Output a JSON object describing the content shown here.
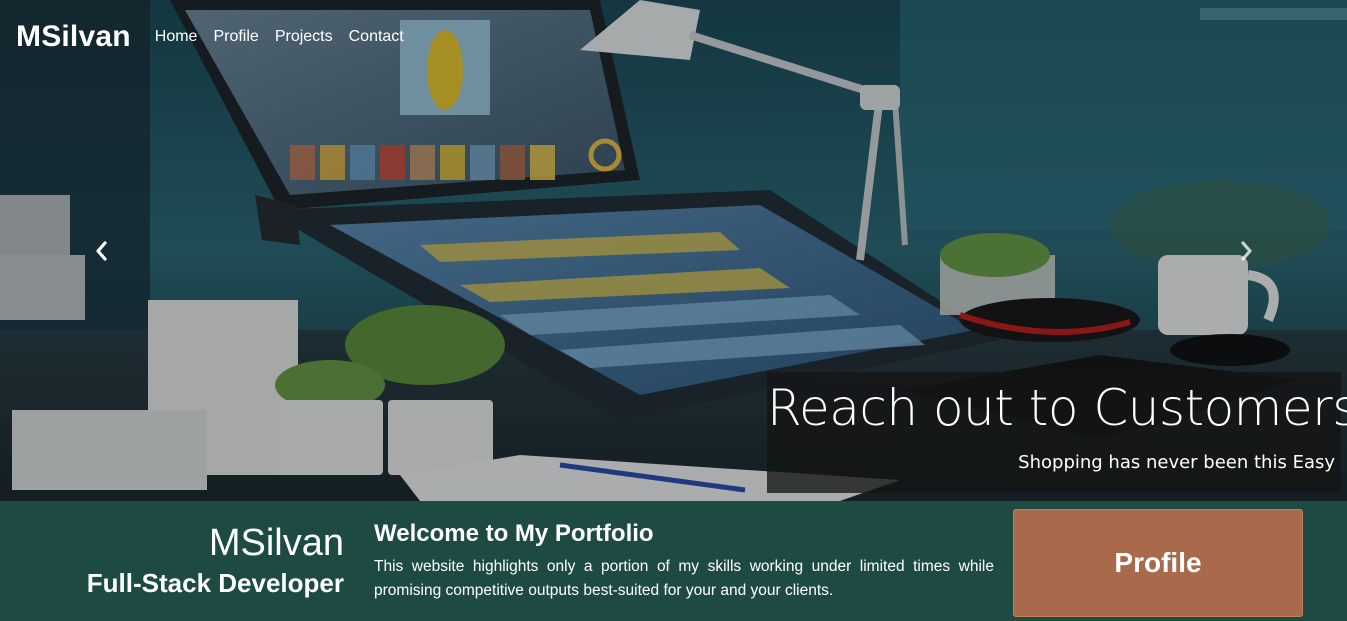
{
  "navbar": {
    "brand": "MSilvan",
    "links": [
      "Home",
      "Profile",
      "Projects",
      "Contact"
    ]
  },
  "carousel": {
    "prev_icon": "chevron-left-icon",
    "next_icon": "chevron-right-icon",
    "caption_title": "Reach out to Customers",
    "caption_subtitle": "Shopping has never been this Easy"
  },
  "intro": {
    "name": "MSilvan",
    "role": "Full-Stack Developer",
    "welcome_title": "Welcome to My Portfolio",
    "welcome_text": "This website highlights only a portion of my skills working under limited times while promising competitive outputs best-suited for your and your clients.",
    "profile_button": "Profile"
  },
  "colors": {
    "strip_background": "#1e4a44",
    "profile_button": "#a9694b",
    "caption_background": "#141414"
  }
}
